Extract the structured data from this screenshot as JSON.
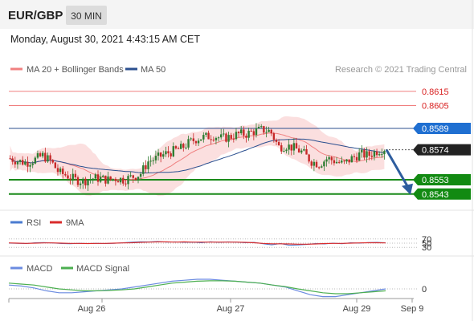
{
  "header": {
    "symbol": "EUR/GBP",
    "timeframe": "30 MIN",
    "datetime": "Monday, August 30, 2021 4:43:15 AM CET"
  },
  "legend": {
    "ma20_bb": "MA 20 + Bollinger Bands",
    "ma50": "MA 50",
    "source": "Research © 2021 Trading Central"
  },
  "colors": {
    "resistance": "#f08080",
    "ma50": "#2b4f8f",
    "support": "#1a8a1a",
    "price_tag": "#222222",
    "candle_up": "#2e7d32",
    "candle_down": "#c62828",
    "bb_fill": "#fad4d4",
    "arrow": "#2e5d9e",
    "rsi": "#4a7bd0",
    "rsi_ma": "#d92b2b",
    "macd": "#6b8be0",
    "macd_signal": "#4caf50"
  },
  "chart_data": [
    {
      "type": "candlestick",
      "x_labels": [
        "Aug 26",
        "Aug 27",
        "Aug 29",
        "Sep 9"
      ],
      "ylim": [
        0.8535,
        0.8625
      ],
      "levels": [
        {
          "label": "0.8615",
          "value": 0.8615,
          "role": "resistance"
        },
        {
          "label": "0.8605",
          "value": 0.8605,
          "role": "resistance"
        },
        {
          "label": "0.8589",
          "value": 0.8589,
          "role": "ma50"
        },
        {
          "label": "0.8574",
          "value": 0.8574,
          "role": "price"
        },
        {
          "label": "0.8553",
          "value": 0.8553,
          "role": "support"
        },
        {
          "label": "0.8543",
          "value": 0.8543,
          "role": "support"
        }
      ],
      "close_path": [
        0.8568,
        0.8566,
        0.8565,
        0.8567,
        0.857,
        0.8566,
        0.8558,
        0.8556,
        0.8553,
        0.8552,
        0.8554,
        0.8554,
        0.8553,
        0.8554,
        0.8553,
        0.8555,
        0.8557,
        0.8566,
        0.8568,
        0.8571,
        0.8573,
        0.8575,
        0.8579,
        0.8582,
        0.8583,
        0.8584,
        0.8582,
        0.8583,
        0.8585,
        0.8585,
        0.8587,
        0.8588,
        0.8587,
        0.8576,
        0.8577,
        0.8575,
        0.8572,
        0.8566,
        0.8564,
        0.8568,
        0.8566,
        0.8564,
        0.8568,
        0.8571,
        0.857,
        0.8573,
        0.8575
      ],
      "forecast": [
        0.8574,
        0.8543
      ]
    },
    {
      "type": "line",
      "name": "RSI",
      "legend": [
        "RSI",
        "9MA"
      ],
      "ticks": [
        "70",
        "50",
        "30"
      ],
      "ylim": [
        0,
        100
      ],
      "rsi": [
        50,
        49,
        48,
        52,
        53,
        51,
        48,
        47,
        49,
        48,
        49,
        48,
        49,
        52,
        55,
        57,
        56,
        58,
        55,
        56,
        54,
        55,
        52,
        57,
        54,
        56,
        55,
        52,
        54,
        47,
        42,
        48,
        40,
        41,
        44,
        48,
        46,
        50,
        47,
        52,
        50,
        53,
        54,
        52
      ],
      "ma": [
        51,
        50,
        49,
        50,
        51,
        51,
        50,
        49,
        49,
        48,
        49,
        49,
        50,
        51,
        52,
        54,
        55,
        56,
        56,
        55,
        56,
        55,
        55,
        55,
        55,
        55,
        55,
        54,
        52,
        49,
        47,
        47,
        46,
        45,
        45,
        46,
        48,
        49,
        49,
        50,
        51,
        52,
        52,
        51
      ]
    },
    {
      "type": "line",
      "name": "MACD",
      "legend": [
        "MACD",
        "MACD Signal"
      ],
      "ticks": [
        "0"
      ],
      "macd": [
        0.0002,
        0.00015,
        5e-05,
        -0.0001,
        -0.0002,
        -0.0002,
        -0.00015,
        -0.0001,
        -5e-05,
        0.0,
        0.0001,
        0.0002,
        0.0003,
        0.0004,
        0.00045,
        0.0005,
        0.0005,
        0.00045,
        0.0004,
        0.00035,
        0.0003,
        0.0002,
        0.0001,
        -0.0001,
        -0.0003,
        -0.0004,
        -0.0004,
        -0.0003,
        -0.0002,
        -0.0001,
        0.0
      ],
      "signal": [
        0.0003,
        0.00025,
        0.0002,
        0.0001,
        0.0,
        -5e-05,
        -0.0001,
        -0.0001,
        -8e-05,
        -5e-05,
        0.0,
        0.0001,
        0.0002,
        0.0003,
        0.00035,
        0.0004,
        0.00042,
        0.00042,
        0.0004,
        0.00035,
        0.0003,
        0.0002,
        0.00012,
        0.0,
        -0.0001,
        -0.0002,
        -0.00025,
        -0.00025,
        -0.0002,
        -0.00015,
        -0.0001
      ]
    }
  ]
}
